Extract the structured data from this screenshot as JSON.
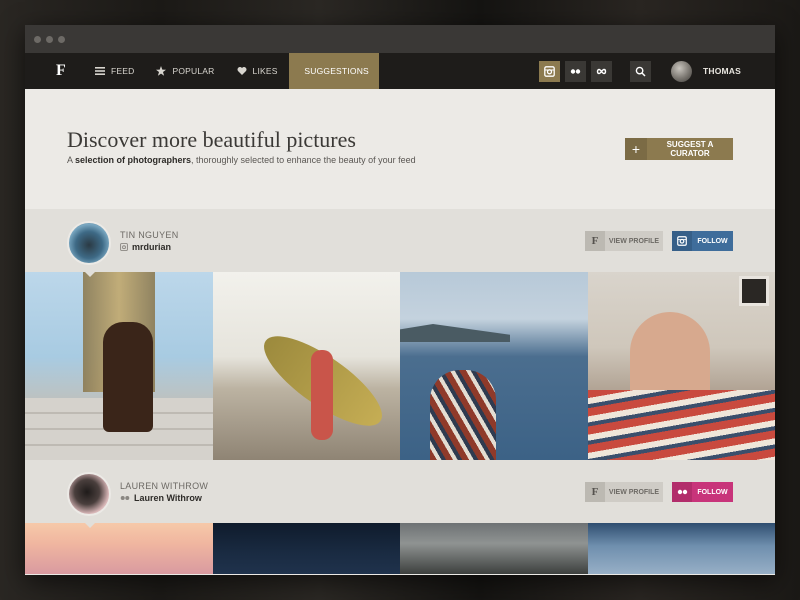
{
  "nav": {
    "logo": "F",
    "items": [
      {
        "label": "FEED",
        "icon": "menu-icon"
      },
      {
        "label": "POPULAR",
        "icon": "star-icon"
      },
      {
        "label": "LIKES",
        "icon": "heart-icon"
      },
      {
        "label": "SUGGESTIONS",
        "icon": "users-icon",
        "active": true
      }
    ],
    "services": [
      "instagram-icon",
      "flickr-icon",
      "infinity-icon"
    ],
    "search_icon": "search-icon",
    "user_name": "THOMAS"
  },
  "hero": {
    "title": "Discover more beautiful pictures",
    "subtitle_a": "A ",
    "subtitle_b": "selection of photographers",
    "subtitle_c": ", thoroughly selected to enhance the beauty of your feed",
    "button": "SUGGEST A CURATOR"
  },
  "curators": [
    {
      "name": "TIN NGUYEN",
      "handle": "mrdurian",
      "source": "instagram",
      "profile_label": "VIEW PROFILE",
      "follow_label": "FOLLOW"
    },
    {
      "name": "LAUREN WITHROW",
      "handle": "Lauren Withrow",
      "source": "flickr",
      "profile_label": "VIEW PROFILE",
      "follow_label": "FOLLOW"
    }
  ],
  "colors": {
    "accent_gold": "#8c7a4f",
    "instagram_blue": "#3f6d9b",
    "flickr_pink": "#c8347a",
    "navbar": "#1e1c1a"
  }
}
